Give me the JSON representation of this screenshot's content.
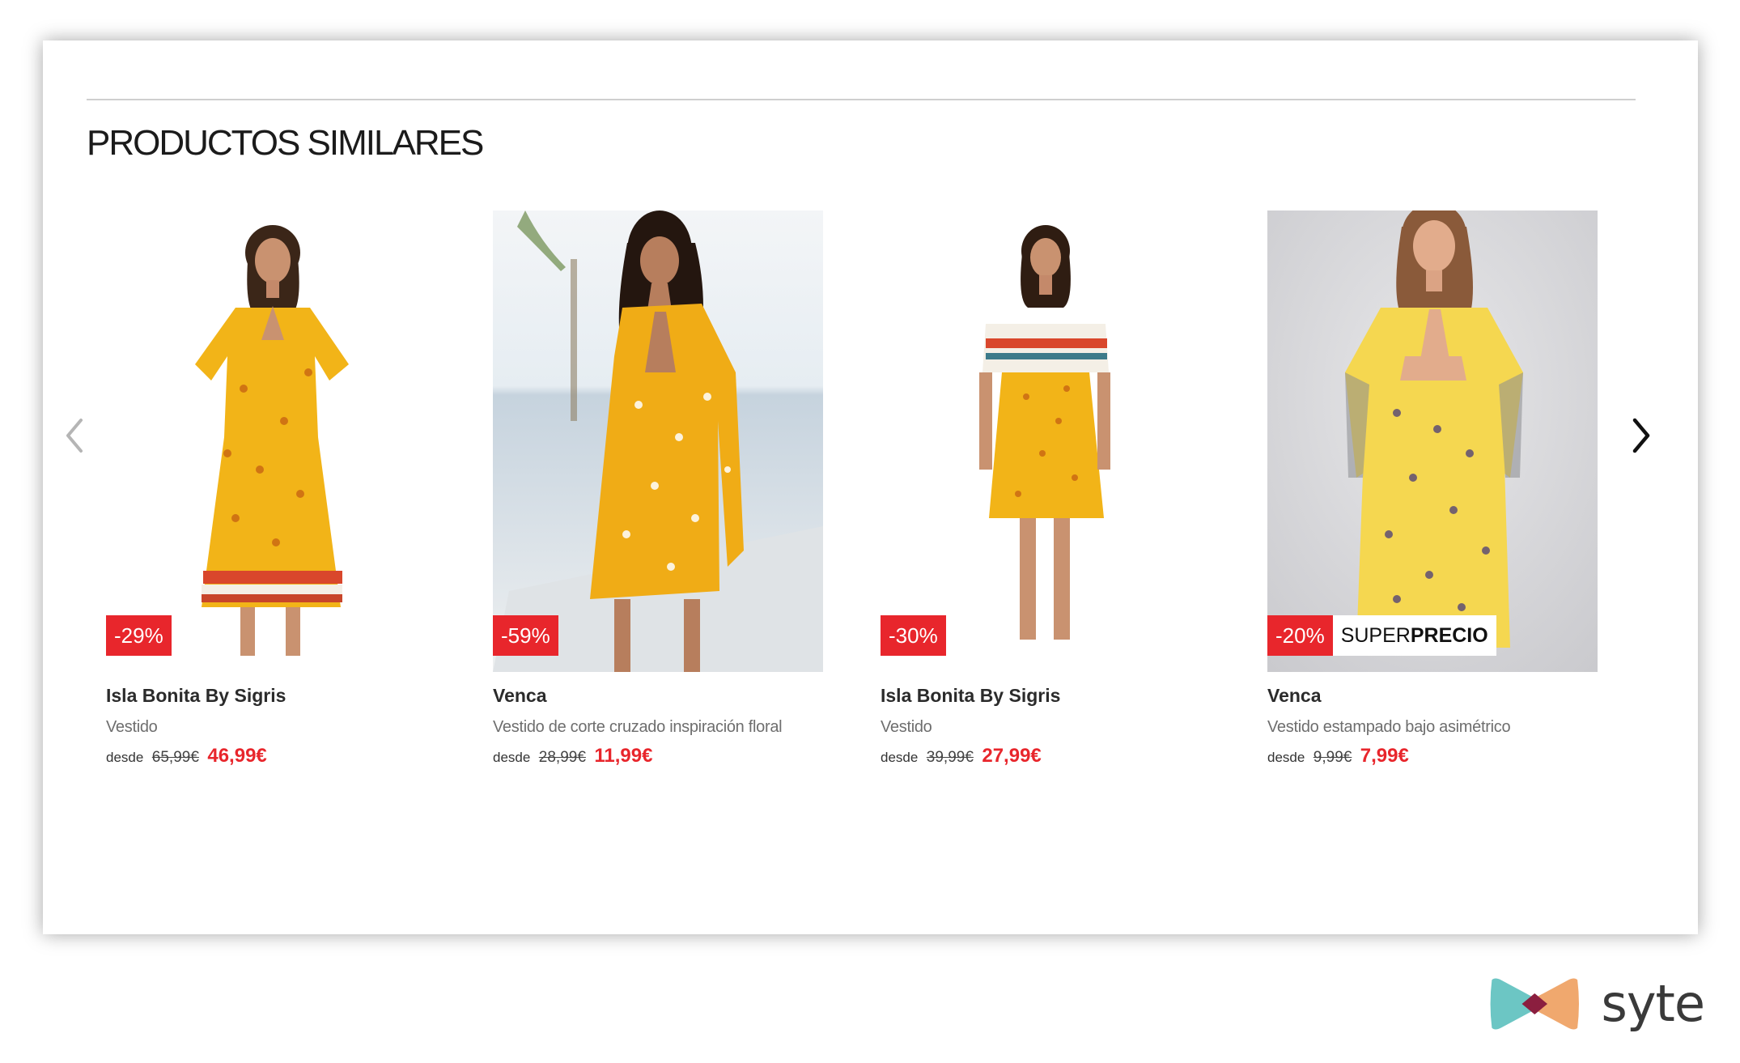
{
  "section": {
    "title": "PRODUCTOS SIMILARES"
  },
  "carousel": {
    "prev_icon": "chevron-left-icon",
    "next_icon": "chevron-right-icon"
  },
  "products": [
    {
      "discount": "-29%",
      "brand": "Isla Bonita By Sigris",
      "description": "Vestido",
      "from_label": "desde",
      "old_price": "65,99€",
      "new_price": "46,99€"
    },
    {
      "discount": "-59%",
      "brand": "Venca",
      "description": "Vestido de corte cruzado inspiración floral",
      "from_label": "desde",
      "old_price": "28,99€",
      "new_price": "11,99€"
    },
    {
      "discount": "-30%",
      "brand": "Isla Bonita By Sigris",
      "description": "Vestido",
      "from_label": "desde",
      "old_price": "39,99€",
      "new_price": "27,99€"
    },
    {
      "discount": "-20%",
      "badge_super_light": "SUPER",
      "badge_super_bold": "PRECIO",
      "brand": "Venca",
      "description": "Vestido estampado bajo asimétrico",
      "from_label": "desde",
      "old_price": "9,99€",
      "new_price": "7,99€"
    }
  ],
  "logo": {
    "text": "syte"
  },
  "colors": {
    "discount_red": "#e8262c",
    "dress_yellow": "#f2b418",
    "logo_teal": "#6cc6c4",
    "logo_orange": "#f0a86e",
    "logo_maroon": "#8b1e3f"
  }
}
